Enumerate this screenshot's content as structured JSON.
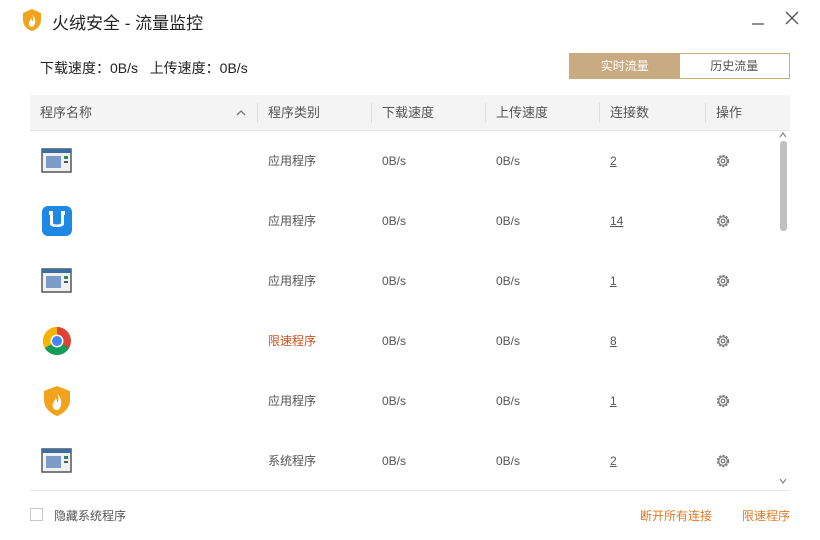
{
  "window": {
    "title": "火绒安全 - 流量监控"
  },
  "summary": {
    "download": "下载速度：0B/s",
    "upload": "上传速度：0B/s"
  },
  "tabs": [
    {
      "label": "实时流量",
      "active": true
    },
    {
      "label": "历史流量",
      "active": false
    }
  ],
  "table": {
    "columns": {
      "name": "程序名称",
      "type": "程序类别",
      "download": "下载速度",
      "upload": "上传速度",
      "connections": "连接数",
      "action": "操作"
    },
    "rows": [
      {
        "icon": "generic-window-icon",
        "type": "应用程序",
        "download": "0B/s",
        "upload": "0B/s",
        "connections": "2"
      },
      {
        "icon": "blue-app-icon",
        "type": "应用程序",
        "download": "0B/s",
        "upload": "0B/s",
        "connections": "14"
      },
      {
        "icon": "generic-window-icon",
        "type": "应用程序",
        "download": "0B/s",
        "upload": "0B/s",
        "connections": "1"
      },
      {
        "icon": "chrome-icon",
        "type": "限速程序",
        "download": "0B/s",
        "upload": "0B/s",
        "connections": "8"
      },
      {
        "icon": "huorong-shield-icon",
        "type": "应用程序",
        "download": "0B/s",
        "upload": "0B/s",
        "connections": "1"
      },
      {
        "icon": "generic-window-icon",
        "type": "系统程序",
        "download": "0B/s",
        "upload": "0B/s",
        "connections": "2"
      }
    ]
  },
  "footer": {
    "hide_system": "隐藏系统程序",
    "close_all": "断开所有连接",
    "limit": "限速程序"
  },
  "colors": {
    "accent": "#c9ab82",
    "limited": "#c8501e",
    "link": "#e07a26"
  }
}
